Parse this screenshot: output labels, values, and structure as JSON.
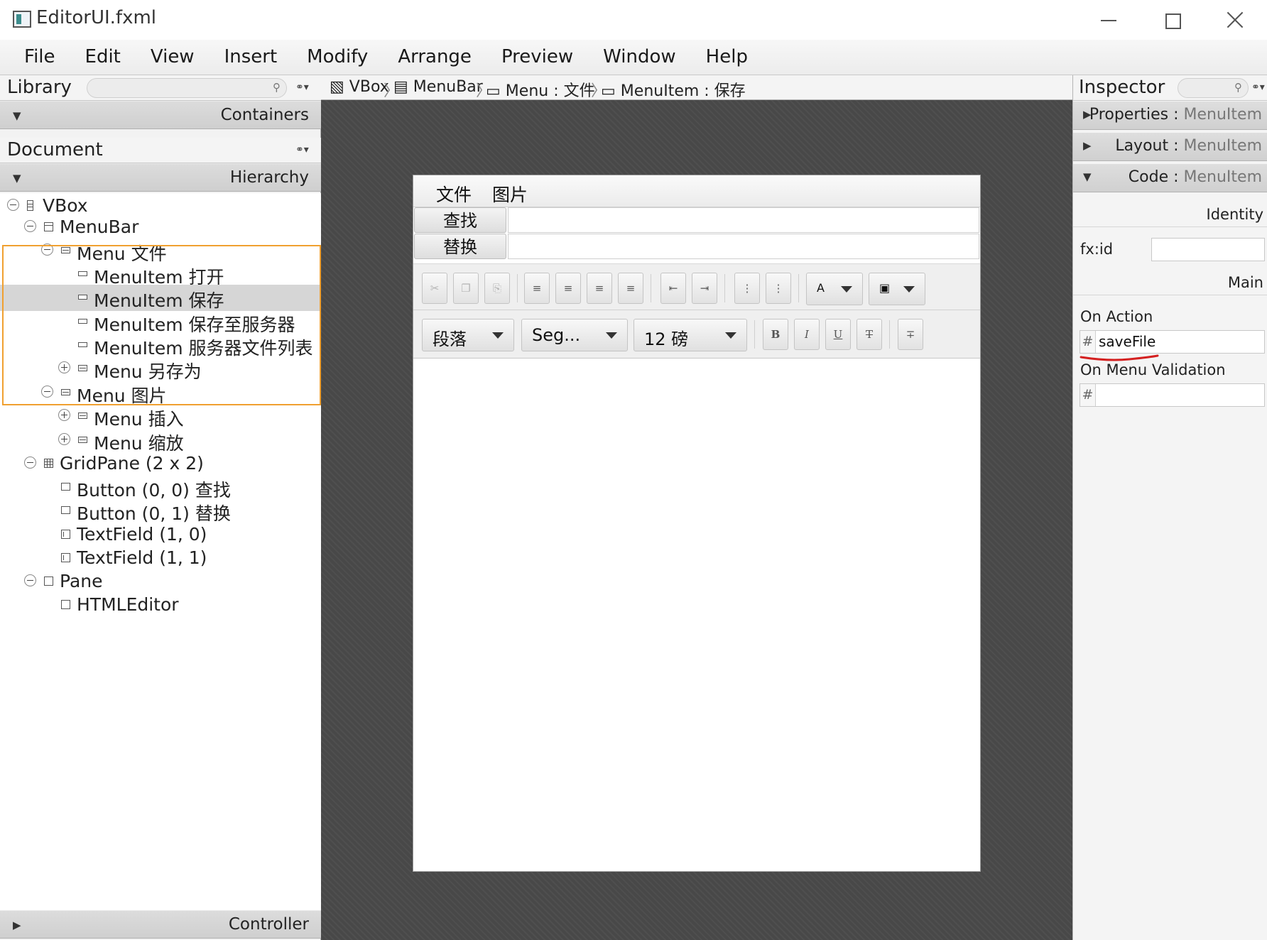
{
  "window": {
    "title": "EditorUI.fxml"
  },
  "menubar": [
    "File",
    "Edit",
    "View",
    "Insert",
    "Modify",
    "Arrange",
    "Preview",
    "Window",
    "Help"
  ],
  "library": {
    "title": "Library",
    "section": "Containers"
  },
  "document": {
    "title": "Document",
    "section": "Hierarchy",
    "tree": [
      {
        "label": "VBox",
        "icon": "vbox-icon",
        "toggle": "collapse"
      },
      {
        "label": "MenuBar",
        "icon": "menubar-icon",
        "toggle": "collapse"
      },
      {
        "label": "Menu 文件",
        "icon": "menu-icon",
        "toggle": "collapse"
      },
      {
        "label": "MenuItem 打开",
        "icon": "menuitem-icon",
        "toggle": ""
      },
      {
        "label": "MenuItem 保存",
        "icon": "menuitem-icon",
        "toggle": "",
        "selected": true
      },
      {
        "label": "MenuItem 保存至服务器",
        "icon": "menuitem-icon",
        "toggle": ""
      },
      {
        "label": "MenuItem 服务器文件列表",
        "icon": "menuitem-icon",
        "toggle": ""
      },
      {
        "label": "Menu 另存为",
        "icon": "menu-icon",
        "toggle": "expand"
      },
      {
        "label": "Menu 图片",
        "icon": "menu-icon",
        "toggle": "collapse"
      },
      {
        "label": "Menu 插入",
        "icon": "menu-icon",
        "toggle": "expand"
      },
      {
        "label": "Menu 缩放",
        "icon": "menu-icon",
        "toggle": "expand"
      },
      {
        "label": "GridPane (2 x 2)",
        "icon": "gridpane-icon",
        "toggle": "collapse"
      },
      {
        "label": "Button (0, 0) 查找",
        "icon": "button-icon",
        "toggle": ""
      },
      {
        "label": "Button (0, 1) 替换",
        "icon": "button-icon",
        "toggle": ""
      },
      {
        "label": "TextField (1, 0)",
        "icon": "textfield-icon",
        "toggle": ""
      },
      {
        "label": "TextField (1, 1)",
        "icon": "textfield-icon",
        "toggle": ""
      },
      {
        "label": "Pane",
        "icon": "pane-icon",
        "toggle": "collapse"
      },
      {
        "label": "HTMLEditor",
        "icon": "htmleditor-icon",
        "toggle": ""
      }
    ],
    "controller": "Controller"
  },
  "breadcrumb": [
    "VBox",
    "MenuBar",
    "Menu : 文件",
    "MenuItem : 保存"
  ],
  "preview": {
    "menus": [
      "文件",
      "图片"
    ],
    "grid_buttons": [
      "查找",
      "替换"
    ],
    "editor": {
      "format_select": "段落",
      "font_select": "Seg...",
      "size_select": "12 磅",
      "toolbar1_icons": [
        "cut-icon",
        "copy-icon",
        "paste-icon",
        "align-left-icon",
        "align-center-icon",
        "align-right-icon",
        "align-justify-icon",
        "outdent-icon",
        "indent-icon",
        "bullet-list-icon",
        "numbered-list-icon",
        "text-color-icon",
        "background-color-icon"
      ],
      "toolbar2_icons": [
        "bold-icon",
        "italic-icon",
        "underline-icon",
        "strikethrough-icon",
        "horizontal-rule-icon"
      ]
    }
  },
  "inspector": {
    "title": "Inspector",
    "sections": [
      {
        "name": "Properties",
        "sub": "MenuItem",
        "state": "collapsed"
      },
      {
        "name": "Layout",
        "sub": "MenuItem",
        "state": "collapsed"
      },
      {
        "name": "Code",
        "sub": "MenuItem",
        "state": "expanded"
      }
    ],
    "identity_header": "Identity",
    "fx_id_label": "fx:id",
    "fx_id_value": "",
    "main_header": "Main",
    "on_action_label": "On Action",
    "on_action_value": "saveFile",
    "on_menu_validation_label": "On Menu Validation",
    "on_menu_validation_value": "",
    "hash_prefix": "#",
    "colors": {
      "selection_highlight": "#f0a030",
      "annotation_underline": "#d42020",
      "canvas": "#484848"
    }
  }
}
